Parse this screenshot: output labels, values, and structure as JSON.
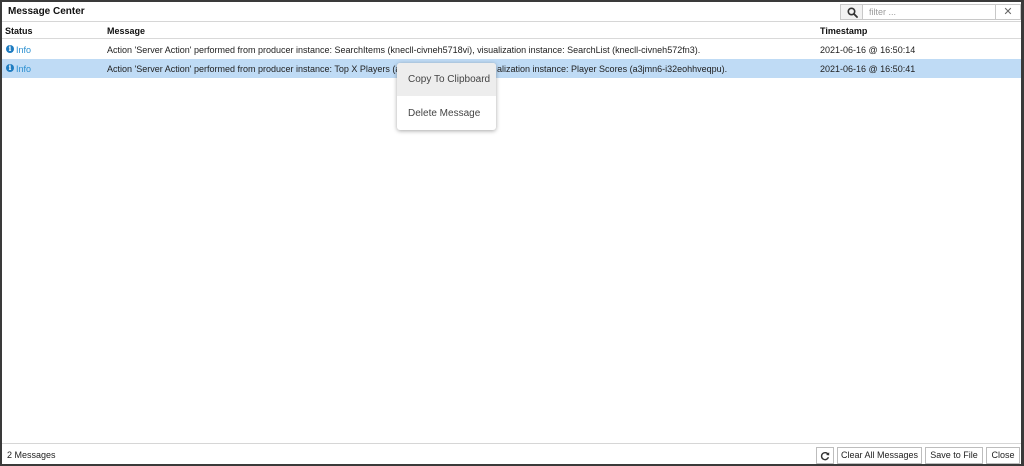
{
  "window": {
    "title": "Message Center",
    "filter": {
      "placeholder": "filter ...",
      "value": "",
      "clear_glyph": "✕"
    }
  },
  "table": {
    "columns": [
      "Status",
      "Message",
      "Timestamp"
    ],
    "rows": [
      {
        "status": "Info",
        "message": "Action 'Server Action' performed from producer instance: SearchItems (knecll-civneh5718vi), visualization instance: SearchList (knecll-civneh572fn3).",
        "timestamp": "2021-06-16 @ 16:50:14",
        "selected": false
      },
      {
        "status": "Info",
        "message_visible_left": "Action 'Server Action' performed from producer instance: Top X Players (a3j",
        "message_visible_right": "alization instance: Player Scores (a3jmn6-i32eohhveqpu).",
        "timestamp": "2021-06-16 @ 16:50:41",
        "selected": true
      }
    ]
  },
  "context_menu": {
    "items": [
      "Copy To Clipboard",
      "Delete Message"
    ]
  },
  "footer": {
    "count_label": "2 Messages",
    "buttons": {
      "clear_all": "Clear All Messages",
      "save": "Save to File",
      "close": "Close"
    }
  },
  "icons": {
    "search": "search-icon",
    "info": "info-icon",
    "refresh": "refresh-icon",
    "close": "close-icon"
  },
  "colors": {
    "selected_row": "#bfdbf5",
    "info_text": "#2a8fd0",
    "info_icon": "#1e7cc1"
  }
}
